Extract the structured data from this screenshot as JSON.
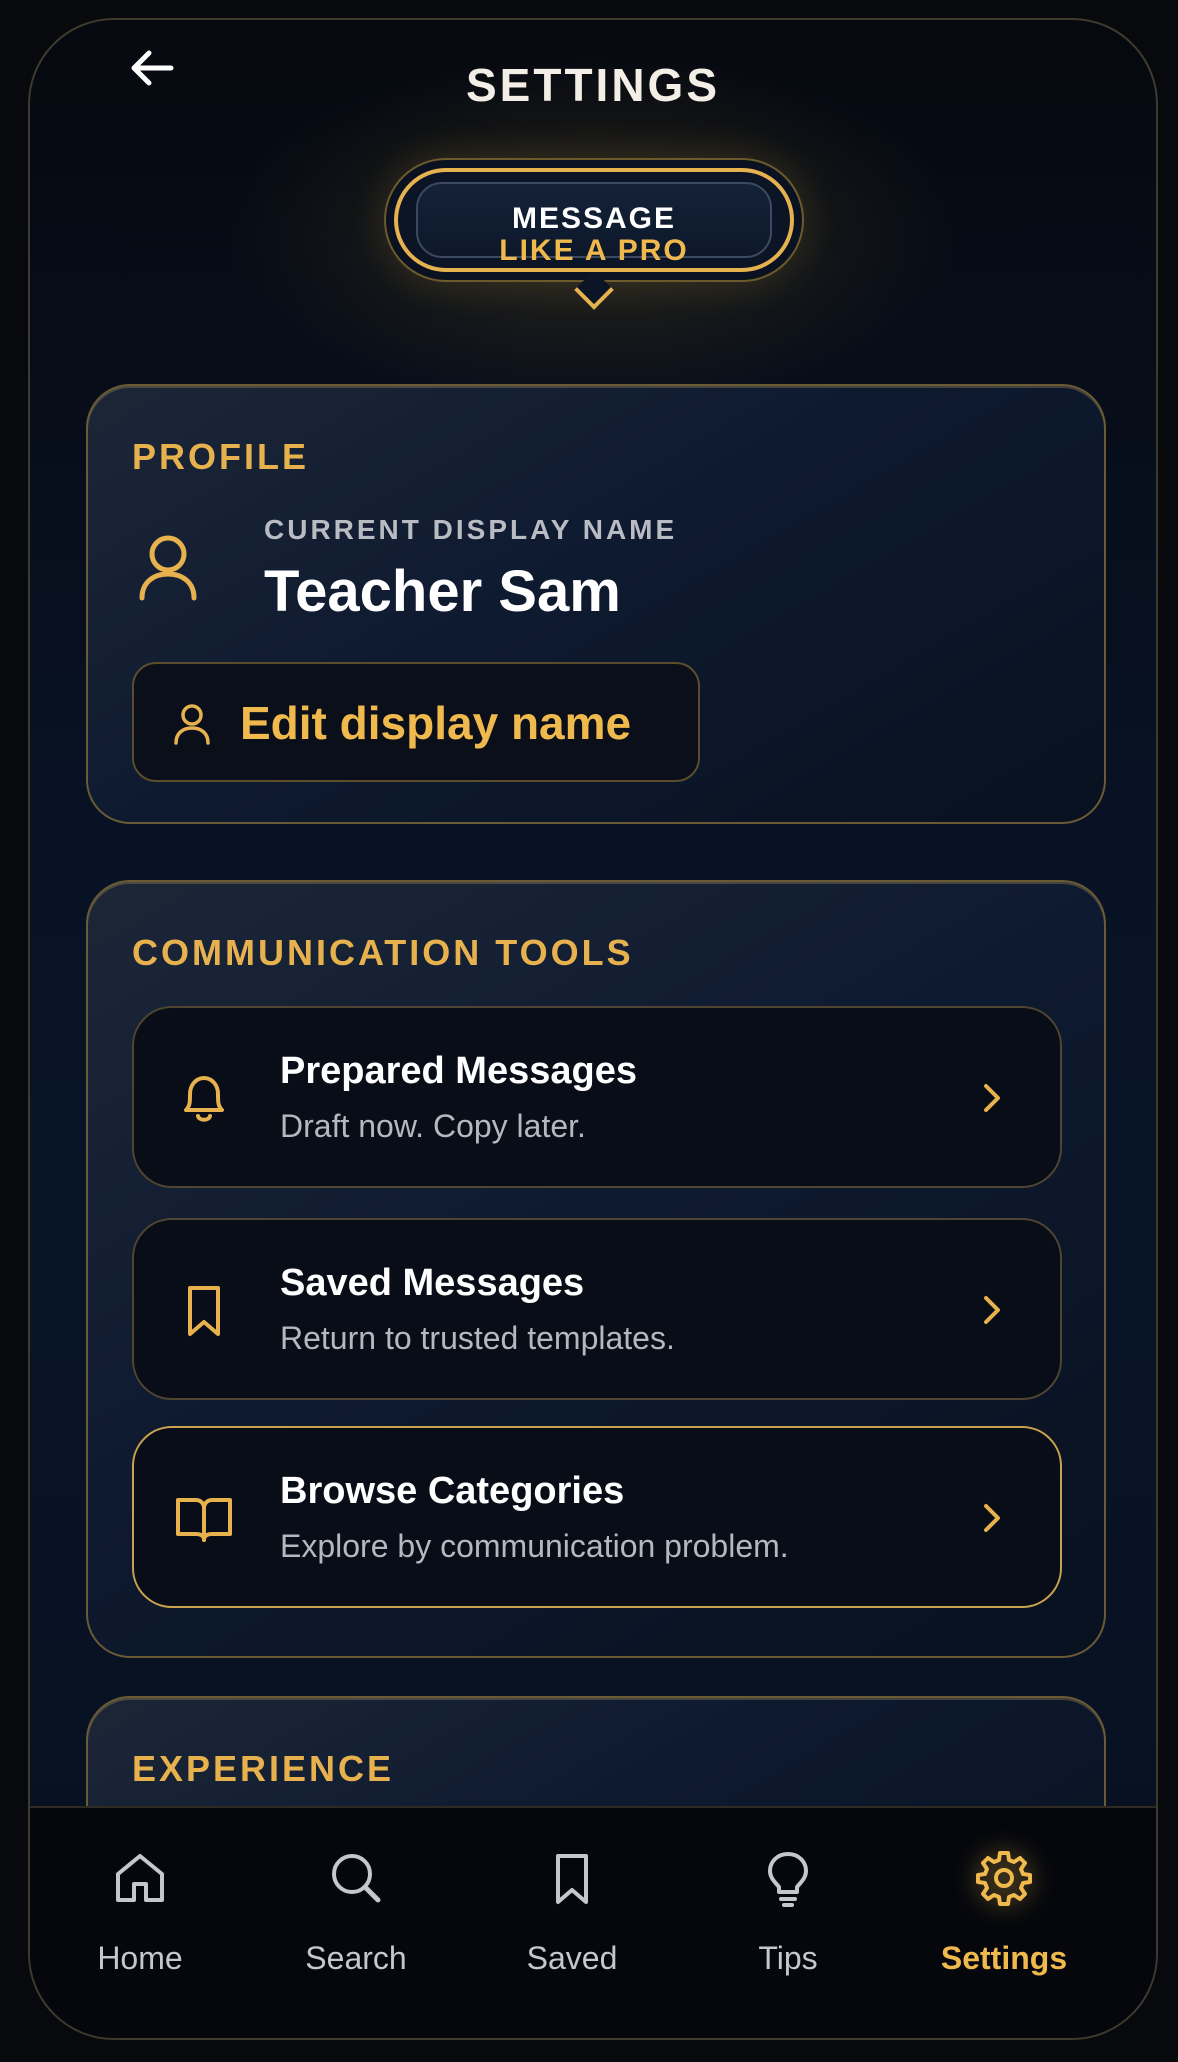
{
  "header": {
    "title": "SETTINGS",
    "back_icon": "arrow-left-icon"
  },
  "badge": {
    "line1": "MESSAGE",
    "line2": "LIKE A PRO"
  },
  "profile": {
    "section_label": "PROFILE",
    "current_label": "CURRENT DISPLAY NAME",
    "display_name": "Teacher Sam",
    "edit_button_label": "Edit display name",
    "icon": "user-icon"
  },
  "tools": {
    "section_label": "COMMUNICATION TOOLS",
    "items": [
      {
        "title": "Prepared Messages",
        "subtitle": "Draft now. Copy later.",
        "icon": "bell-icon"
      },
      {
        "title": "Saved Messages",
        "subtitle": "Return to trusted templates.",
        "icon": "bookmark-icon"
      },
      {
        "title": "Browse Categories",
        "subtitle": "Explore by communication problem.",
        "icon": "book-open-icon"
      }
    ]
  },
  "experience": {
    "section_label": "EXPERIENCE"
  },
  "nav": {
    "items": [
      {
        "label": "Home",
        "icon": "home-icon"
      },
      {
        "label": "Search",
        "icon": "search-icon"
      },
      {
        "label": "Saved",
        "icon": "bookmark-icon"
      },
      {
        "label": "Tips",
        "icon": "lightbulb-icon"
      },
      {
        "label": "Settings",
        "icon": "gear-icon",
        "active": true
      }
    ]
  },
  "colors": {
    "accent": "#f0b94d",
    "background": "#081428",
    "card_border": "#6a5a35",
    "text_primary": "#ffffff",
    "text_secondary": "#b5b8be"
  }
}
